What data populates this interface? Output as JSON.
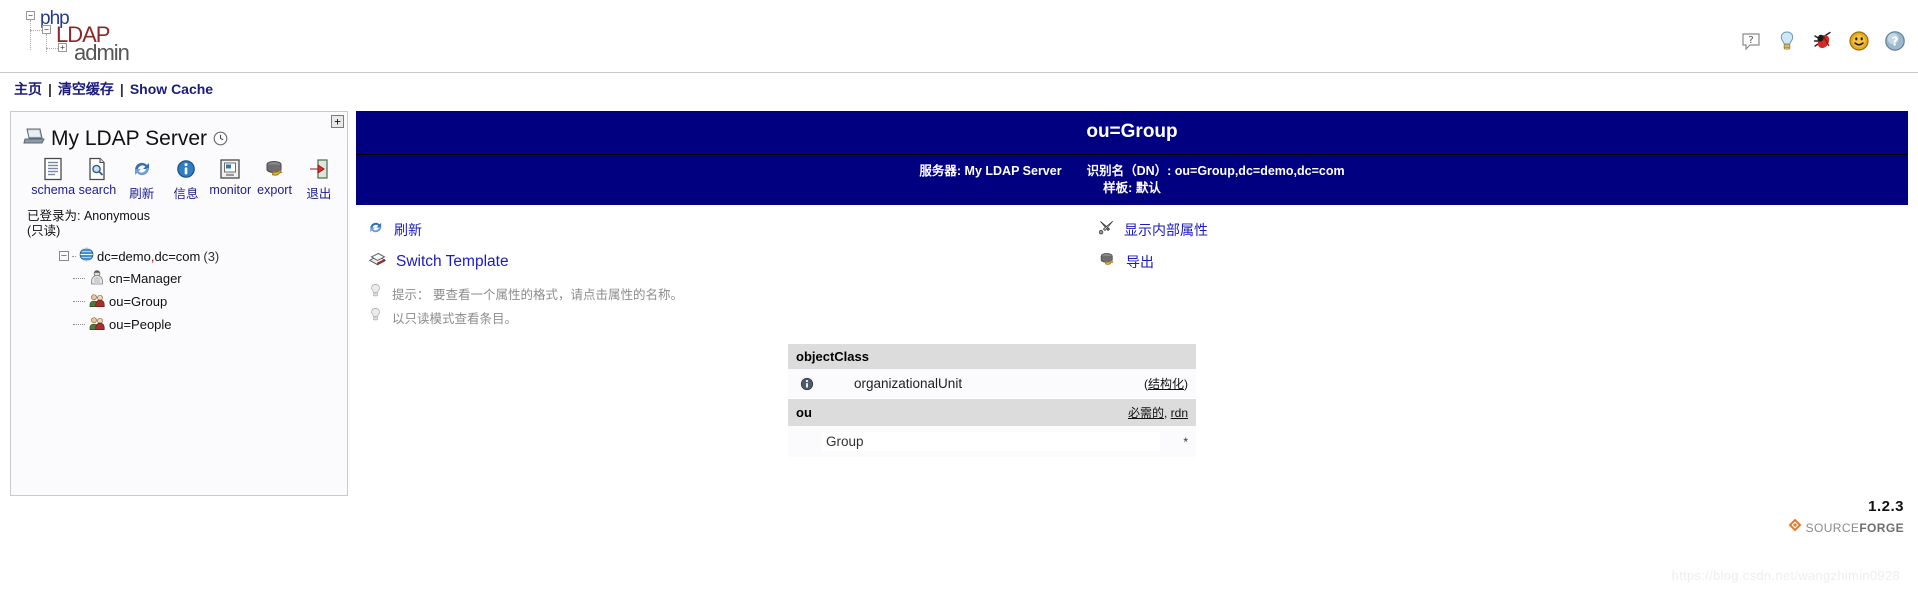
{
  "app": {
    "logo": {
      "php": "php",
      "ldap": "LDAP",
      "admin": "admin"
    },
    "version": "1.2.3",
    "sourceforge": {
      "source": "SOURCE",
      "forge": "FORGE"
    },
    "watermark": "https://blog.csdn.net/wangzhimin0928"
  },
  "header_icons": [
    {
      "name": "help-bubble-icon",
      "title": "?"
    },
    {
      "name": "lightbulb-icon",
      "title": "hints"
    },
    {
      "name": "bug-icon",
      "title": "report bug"
    },
    {
      "name": "smiley-icon",
      "title": "feedback"
    },
    {
      "name": "question-help-icon",
      "title": "help"
    }
  ],
  "navbar": {
    "home": "主页",
    "purge_cache": "清空缓存",
    "show_cache": "Show Cache",
    "separator": "|"
  },
  "sidebar": {
    "collapse_label": "+",
    "server_name": "My LDAP Server",
    "tools": [
      {
        "label": "schema",
        "icon": "schema-icon"
      },
      {
        "label": "search",
        "icon": "search-icon"
      },
      {
        "label": "刷新",
        "icon": "refresh-icon"
      },
      {
        "label": "信息",
        "icon": "info-icon"
      },
      {
        "label": "monitor",
        "icon": "monitor-icon"
      },
      {
        "label": "export",
        "icon": "export-icon"
      },
      {
        "label": "退出",
        "icon": "logout-icon"
      }
    ],
    "login_line1": "已登录为: Anonymous",
    "login_line2": "(只读)",
    "tree": {
      "root": {
        "label_a": "dc=demo",
        "comma": ",",
        "label_b": "dc=com",
        "count": "(3)",
        "expander": "–"
      },
      "children": [
        {
          "label": "cn=Manager",
          "icon": "user-icon"
        },
        {
          "label": "ou=Group",
          "icon": "group-icon"
        },
        {
          "label": "ou=People",
          "icon": "group-icon"
        }
      ]
    }
  },
  "entry": {
    "title": "ou=Group",
    "server_label": "服务器:",
    "server_value": "My LDAP Server",
    "dn_label": "识别名（DN）:",
    "dn_value": "ou=Group,dc=demo,dc=com",
    "template_label": "样板:",
    "template_value": "默认"
  },
  "actions": {
    "left": [
      {
        "label": "刷新",
        "icon": "refresh-icon",
        "type": "link"
      },
      {
        "label": "Switch Template",
        "icon": "template-icon",
        "type": "link"
      }
    ],
    "hints": [
      {
        "label": "提示： 要查看一个属性的格式，请点击属性的名称。",
        "icon": "lightbulb-icon"
      },
      {
        "label": "以只读模式查看条目。",
        "icon": "lightbulb-icon"
      }
    ],
    "right": [
      {
        "label": "显示内部属性",
        "icon": "tools-icon",
        "type": "link"
      },
      {
        "label": "导出",
        "icon": "export-icon",
        "type": "link"
      }
    ]
  },
  "attributes": [
    {
      "name": "objectClass",
      "flags": "",
      "flag_parts": [],
      "values": [
        {
          "text": "organizationalUnit",
          "note": "(结构化)",
          "has_info_icon": true,
          "is_input": false,
          "star": ""
        }
      ]
    },
    {
      "name": "ou",
      "flags": "必需的, rdn",
      "flag_parts": [
        "必需的",
        ", ",
        "rdn"
      ],
      "values": [
        {
          "text": "Group",
          "note": "",
          "has_info_icon": false,
          "is_input": true,
          "star": "*"
        }
      ]
    }
  ]
}
